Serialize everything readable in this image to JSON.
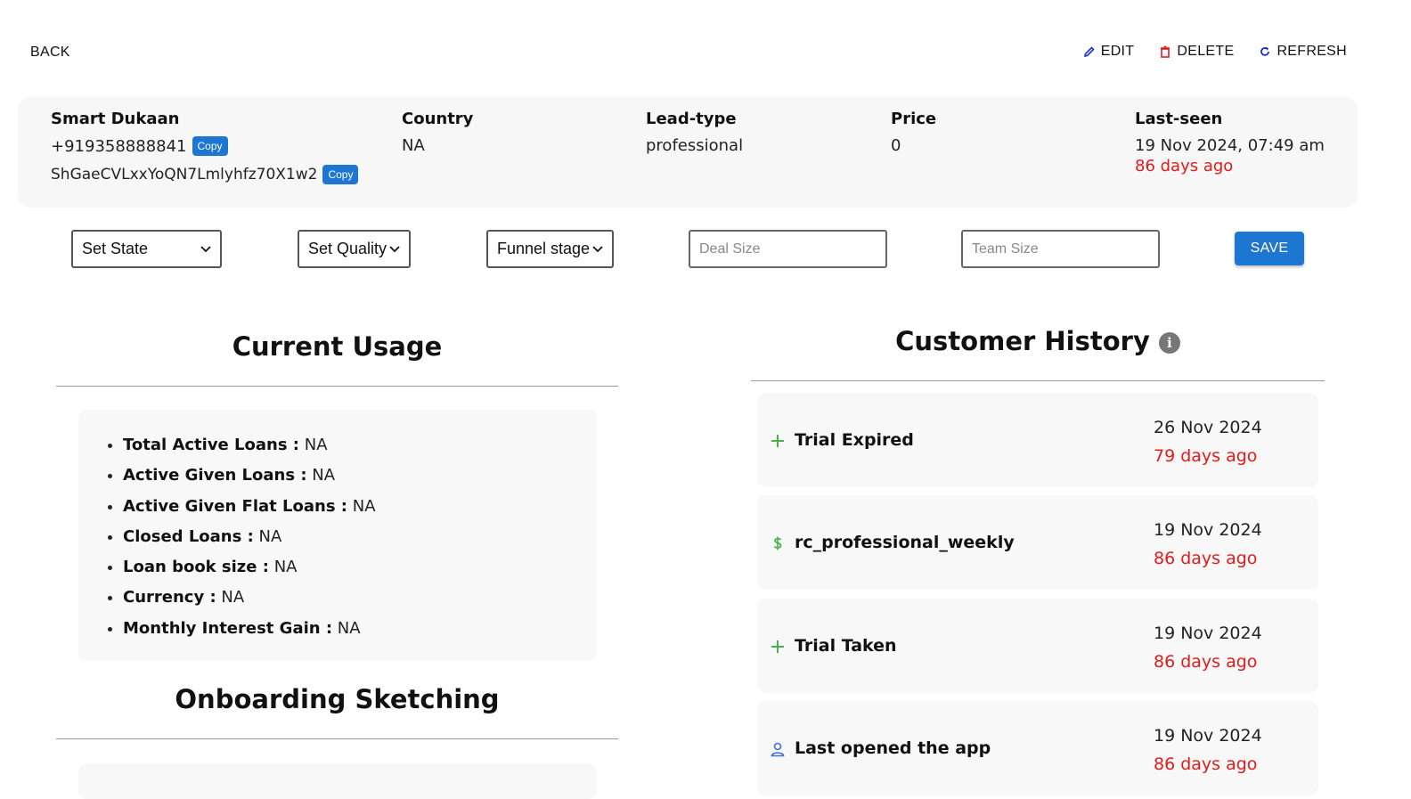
{
  "header": {
    "back_label": "BACK",
    "edit_label": "EDIT",
    "delete_label": "DELETE",
    "refresh_label": "REFRESH"
  },
  "customer": {
    "name": "Smart Dukaan",
    "phone": "+919358888841",
    "uid": "ShGaeCVLxxYoQN7Lmlyhfz70X1w2",
    "copy_label": "Copy",
    "country_label": "Country",
    "country_value": "NA",
    "lead_type_label": "Lead-type",
    "lead_type_value": "professional",
    "price_label": "Price",
    "price_value": "0",
    "last_seen_label": "Last-seen",
    "last_seen_value": "19 Nov 2024, 07:49 am",
    "last_seen_ago": "86 days ago"
  },
  "controls": {
    "state_select": "Set State",
    "quality_select": "Set Quality",
    "funnel_select": "Funnel stage",
    "deal_size_placeholder": "Deal Size",
    "team_size_placeholder": "Team Size",
    "save_label": "SAVE"
  },
  "usage": {
    "title": "Current Usage",
    "items": [
      {
        "label": "Total Active Loans :",
        "value": "NA"
      },
      {
        "label": "Active Given Loans :",
        "value": "NA"
      },
      {
        "label": "Active Given Flat Loans :",
        "value": "NA"
      },
      {
        "label": "Closed Loans :",
        "value": "NA"
      },
      {
        "label": "Loan book size :",
        "value": "NA"
      },
      {
        "label": "Currency :",
        "value": "NA"
      },
      {
        "label": "Monthly Interest Gain :",
        "value": "NA"
      }
    ]
  },
  "onboarding": {
    "title": "Onboarding Sketching"
  },
  "history": {
    "title": "Customer History",
    "items": [
      {
        "icon": "plus-icon",
        "label": "Trial Expired",
        "date": "26 Nov 2024",
        "ago": "79 days ago"
      },
      {
        "icon": "dollar-icon",
        "label": "rc_professional_weekly",
        "date": "19 Nov 2024",
        "ago": "86 days ago"
      },
      {
        "icon": "plus-icon",
        "label": "Trial Taken",
        "date": "19 Nov 2024",
        "ago": "86 days ago"
      },
      {
        "icon": "user-icon",
        "label": "Last opened the app",
        "date": "19 Nov 2024",
        "ago": "86 days ago"
      }
    ]
  },
  "colors": {
    "accent": "#1d76d2",
    "danger_text": "#e21b1b",
    "edit_icon": "#1a2fd6",
    "delete_icon": "#e21b1b",
    "refresh_icon": "#1a2fd6",
    "plus_icon": "#4caf50",
    "dollar_icon": "#4caf50",
    "user_icon": "#3f6fd8"
  }
}
